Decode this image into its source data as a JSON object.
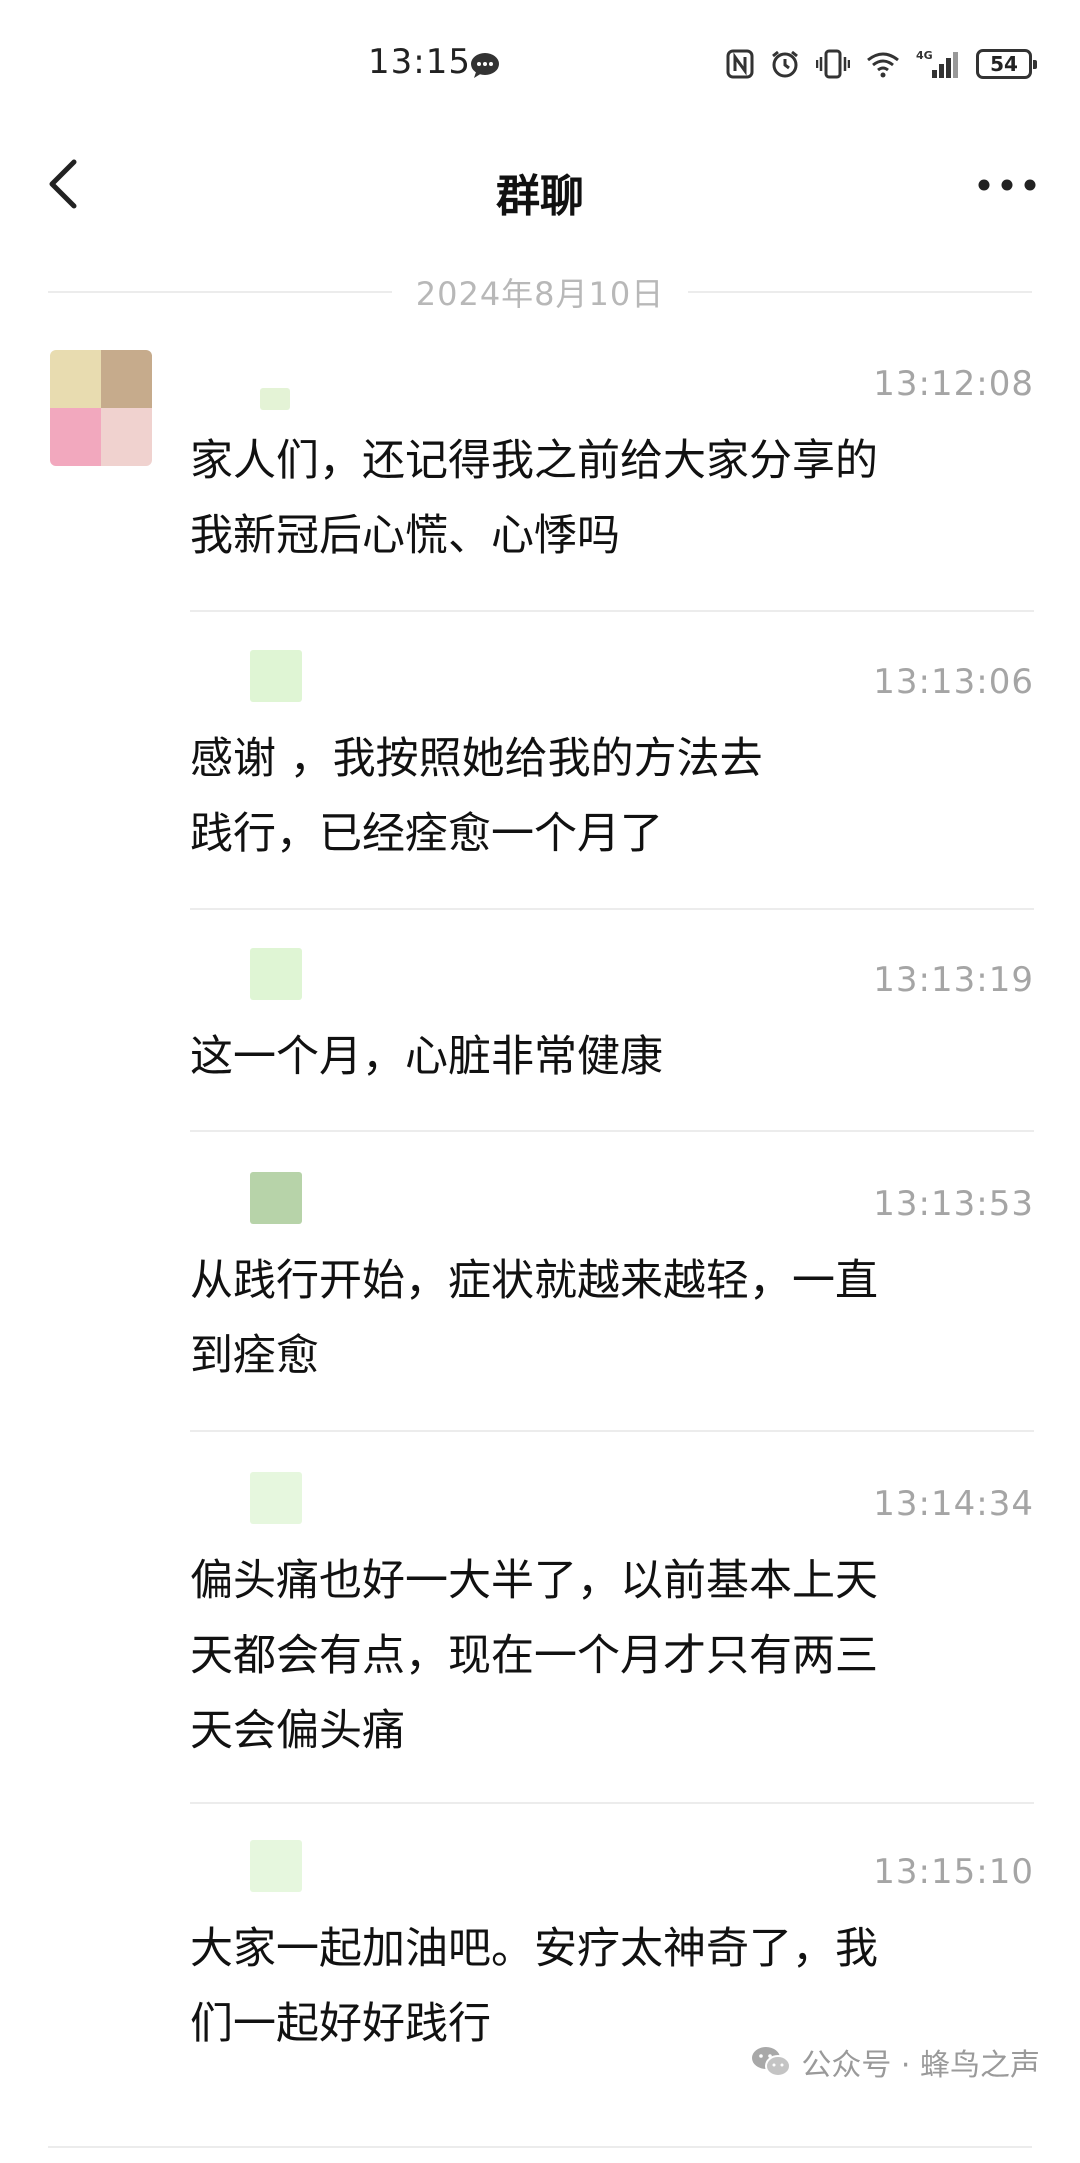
{
  "status_bar": {
    "time": "13:15",
    "network": "4G",
    "battery": "54"
  },
  "header": {
    "title": "群聊"
  },
  "date_divider": "2024年8月10日",
  "messages": [
    {
      "time": "13:12:08",
      "text": "家人们，还记得我之前给大家分享的\n我新冠后心慌、心悸吗"
    },
    {
      "time": "13:13:06",
      "text": "感谢          ，我按照她给我的方法去\n践行，已经痊愈一个月了"
    },
    {
      "time": "13:13:19",
      "text": "这一个月，心脏非常健康"
    },
    {
      "time": "13:13:53",
      "text": "从践行开始，症状就越来越轻，一直\n到痊愈"
    },
    {
      "time": "13:14:34",
      "text": "偏头痛也好一大半了，以前基本上天\n天都会有点，现在一个月才只有两三\n天会偏头痛"
    },
    {
      "time": "13:15:10",
      "text": "大家一起加油吧。安疗太神奇了，我\n们一起好好践行"
    }
  ],
  "watermark": {
    "text": "公众号 · 蜂鸟之声"
  },
  "icons": {
    "status_message": "message-bubble-icon",
    "nfc": "nfc-icon",
    "alarm": "alarm-icon",
    "vibrate": "vibrate-icon",
    "wifi": "wifi-icon",
    "signal": "signal-icon",
    "back": "chevron-left-icon",
    "more": "more-dots-icon",
    "wechat": "wechat-icon"
  }
}
